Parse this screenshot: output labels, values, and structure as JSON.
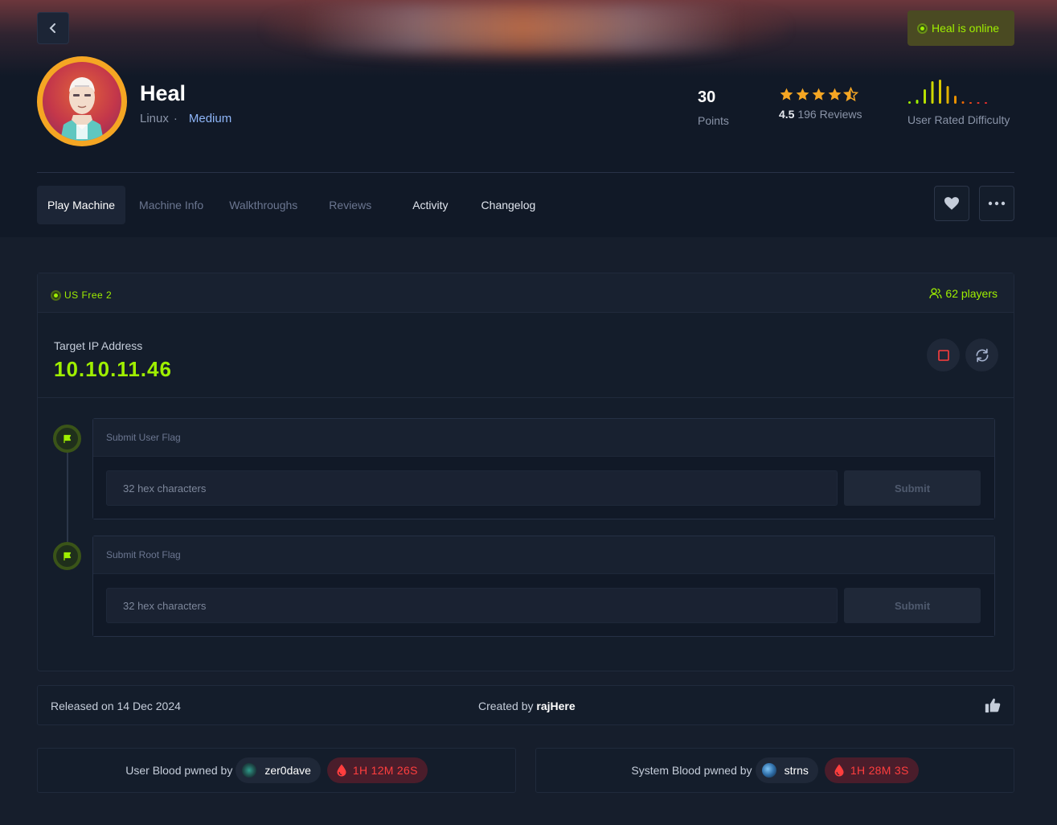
{
  "header": {
    "online_status": "Heal is online",
    "machine_name": "Heal",
    "os": "Linux",
    "separator": "·",
    "difficulty": "Medium",
    "points_value": "30",
    "points_label": "Points",
    "rating_value": "4.5",
    "rating_stars": 4.5,
    "reviews_label": "196 Reviews",
    "user_rated_difficulty_label": "User Rated Difficulty"
  },
  "tabs": [
    {
      "label": "Play Machine",
      "active": true
    },
    {
      "label": "Machine Info"
    },
    {
      "label": "Walkthroughs"
    },
    {
      "label": "Reviews"
    },
    {
      "label": "Activity"
    },
    {
      "label": "Changelog"
    }
  ],
  "play": {
    "server": "US Free 2",
    "players": "62 players",
    "ip_label": "Target IP Address",
    "ip_value": "10.10.11.46"
  },
  "flags": [
    {
      "title": "Submit User Flag",
      "placeholder": "32 hex characters",
      "submit": "Submit"
    },
    {
      "title": "Submit Root Flag",
      "placeholder": "32 hex characters",
      "submit": "Submit"
    }
  ],
  "info": {
    "released": "Released on 14 Dec 2024",
    "created_prefix": "Created by",
    "creator": "rajHere"
  },
  "bloods": {
    "user_label": "User Blood pwned by",
    "user_name": "zer0dave",
    "user_time": "1H 12M 26S",
    "system_label": "System Blood pwned by",
    "system_name": "strns",
    "system_time": "1H 28M 3S"
  },
  "colors": {
    "accent_green": "#9fef00",
    "star_orange": "#f5a623",
    "blood_red": "#ff3e3e",
    "difficulty_blue": "#8eb5f7"
  },
  "icons": [
    "chevron-left-icon",
    "online-dot-icon",
    "star-icon",
    "heart-icon",
    "more-icon",
    "users-icon",
    "stop-icon",
    "refresh-icon",
    "flag-icon",
    "thumbs-up-icon",
    "blood-drop-icon"
  ]
}
